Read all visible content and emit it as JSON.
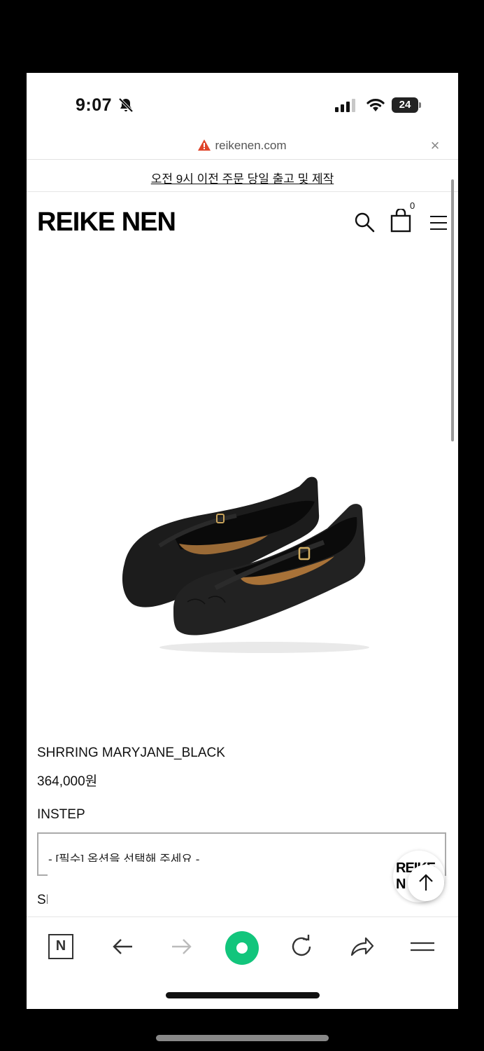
{
  "status_bar": {
    "time": "9:07",
    "battery": "24"
  },
  "browser": {
    "url": "reikenen.com"
  },
  "announcement": "오전 9시 이전 주문 당일 출고 및 제작",
  "header": {
    "logo": "REIKE NEN",
    "cart_count": "0"
  },
  "product": {
    "name": "SHRRING MARYJANE_BLACK",
    "price": "364,000원",
    "option_label": "INSTEP",
    "select_placeholder": "- [필수] 옵션을 선택해 주세요 -",
    "next_label_partial": "SI"
  },
  "floating": {
    "logo_text": "REIKE N"
  },
  "colors": {
    "accent_green": "#12c57c",
    "warning_red": "#e0452b"
  }
}
